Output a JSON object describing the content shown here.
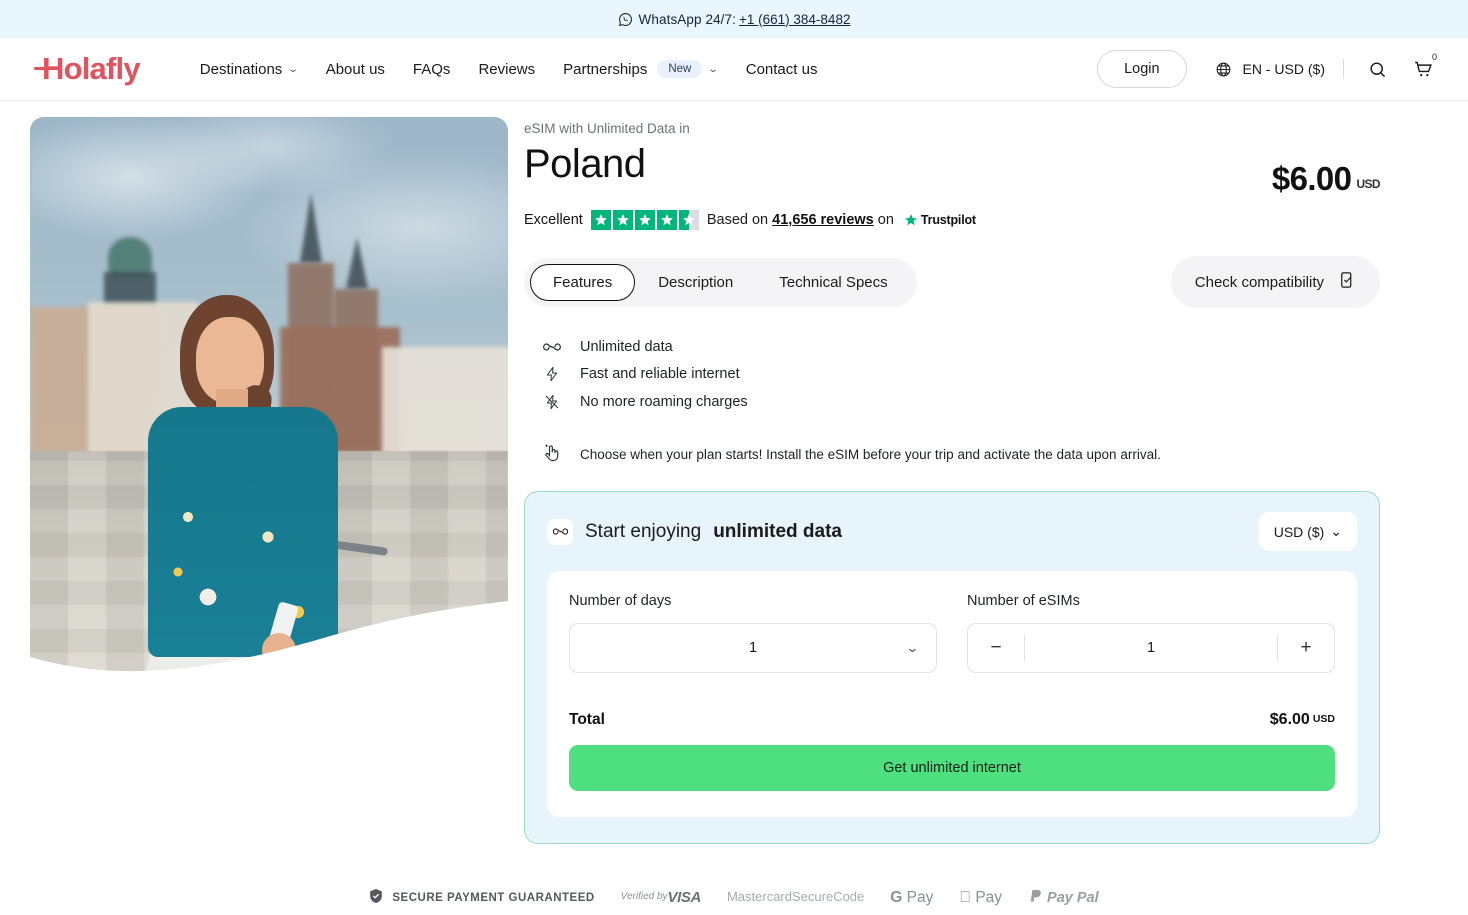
{
  "topbar": {
    "icon": "whatsapp-icon",
    "text": "WhatsApp 24/7:",
    "phone": "+1 (661) 384-8482"
  },
  "nav": {
    "logo": "Holafly",
    "items": [
      {
        "label": "Destinations",
        "has_caret": true
      },
      {
        "label": "About us",
        "has_caret": false
      },
      {
        "label": "FAQs",
        "has_caret": false
      },
      {
        "label": "Reviews",
        "has_caret": false
      },
      {
        "label": "Partnerships",
        "badge": "New",
        "has_caret": true
      },
      {
        "label": "Contact us",
        "has_caret": false
      }
    ],
    "login_label": "Login",
    "language": "EN - USD ($)",
    "search_icon": "search-icon",
    "cart_icon": "cart-icon",
    "cart_count": "0"
  },
  "product": {
    "eyebrow": "eSIM with Unlimited Data in",
    "country": "Poland",
    "price": "$6.00",
    "price_currency": "USD",
    "trust": {
      "rating_word": "Excellent",
      "stars": 4.5,
      "prefix": "Based on",
      "reviews": "41,656 reviews",
      "suffix": "on",
      "brand": "Trustpilot"
    },
    "tabs": [
      {
        "label": "Features",
        "active": true
      },
      {
        "label": "Description",
        "active": false
      },
      {
        "label": "Technical Specs",
        "active": false
      }
    ],
    "compatibility_label": "Check compatibility",
    "features": [
      {
        "icon": "infinity-icon",
        "label": "Unlimited data"
      },
      {
        "icon": "lightning-icon",
        "label": "Fast and reliable internet"
      },
      {
        "icon": "no-roaming-icon",
        "label": "No more roaming charges"
      }
    ],
    "note": {
      "icon": "tap-hand-icon",
      "text": "Choose when your plan starts! Install the eSIM before your trip and activate the data upon arrival."
    }
  },
  "buy": {
    "heading_prefix": "Start enjoying",
    "heading_bold": "unlimited data",
    "currency_selected": "USD ($)",
    "days_label": "Number of days",
    "days_value": "1",
    "esims_label": "Number of eSIMs",
    "esims_value": "1",
    "minus_label": "−",
    "plus_label": "+",
    "total_label": "Total",
    "total_price": "$6.00",
    "total_currency": "USD",
    "cta_label": "Get unlimited internet"
  },
  "payments": {
    "secure_text": "SECURE PAYMENT GUARANTEED",
    "logos": [
      {
        "name": "verified-by-visa",
        "line1": "Verified by",
        "line2": "VISA"
      },
      {
        "name": "mastercard-securecode",
        "line1": "Mastercard",
        "line2": "SecureCode"
      },
      {
        "name": "google-pay",
        "line1": "G",
        "line2": "Pay"
      },
      {
        "name": "apple-pay",
        "line1": "",
        "line2": "Pay"
      },
      {
        "name": "paypal",
        "line1": "Pay",
        "line2": "Pal"
      }
    ]
  },
  "colors": {
    "brand": "#e0535f",
    "cta": "#4ee07f",
    "card_bg": "#e8f4fb",
    "card_border": "#9adcc0",
    "trust_green": "#00b67a",
    "topbar_bg": "#eaf6fd"
  }
}
